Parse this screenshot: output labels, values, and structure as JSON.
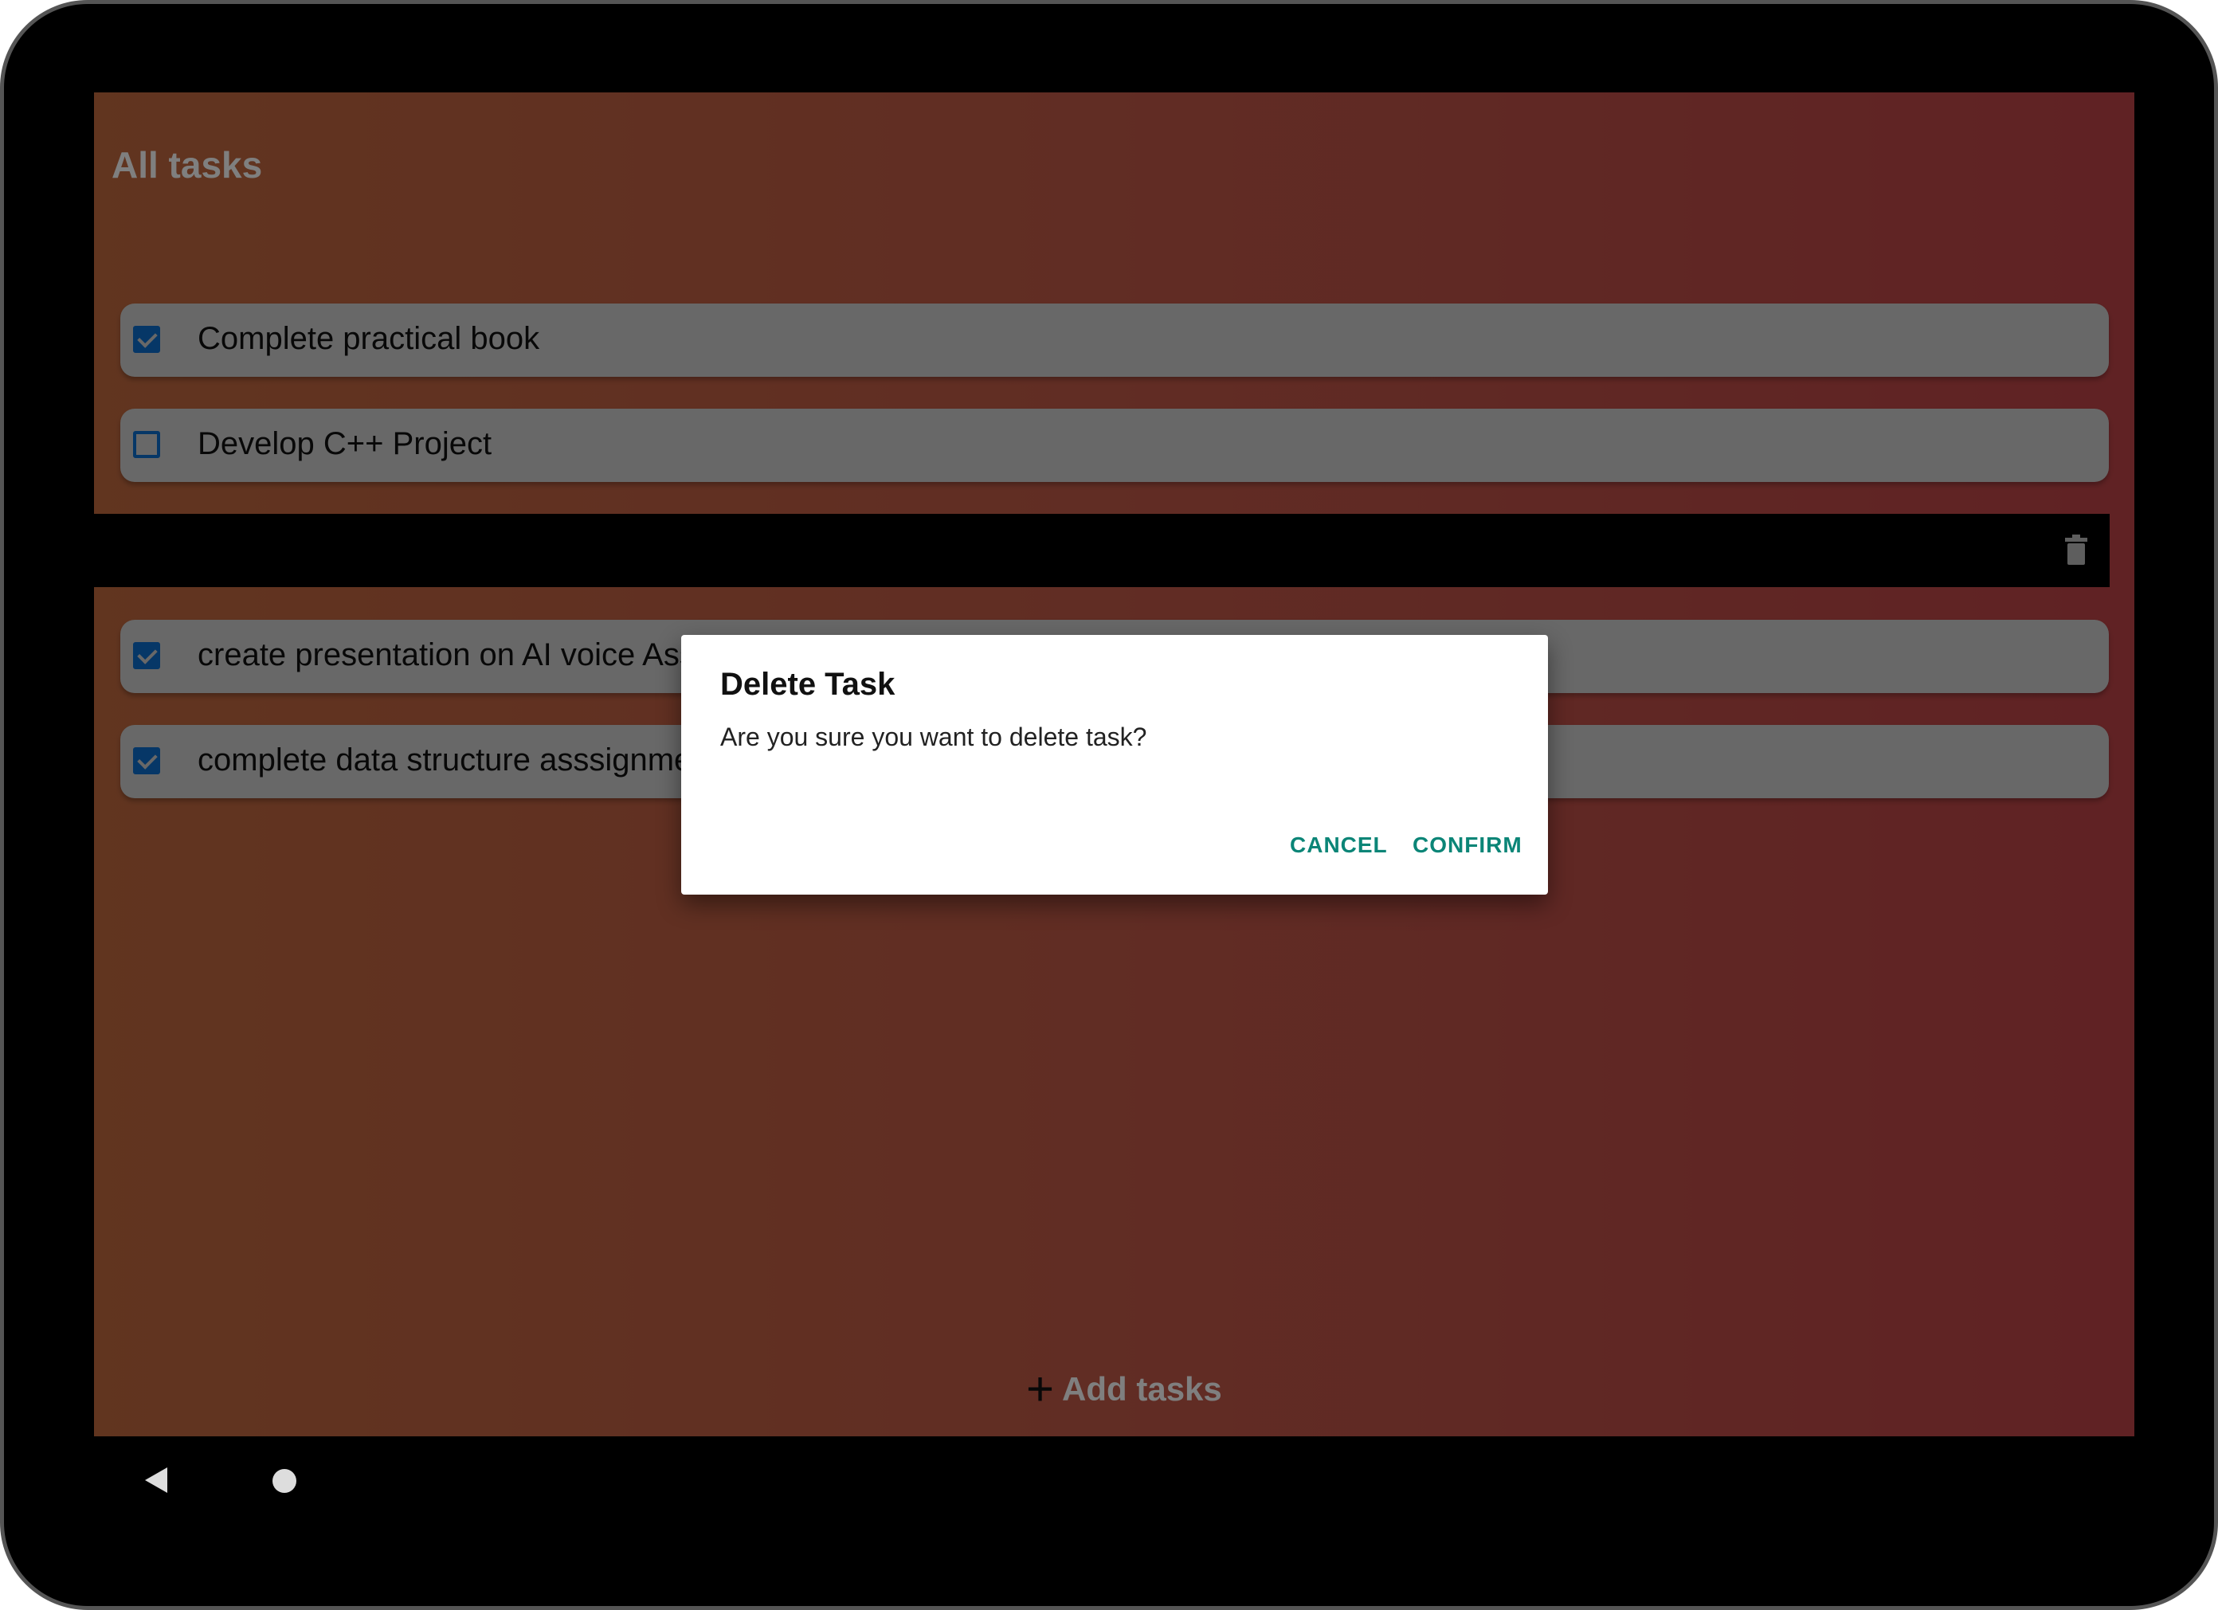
{
  "app": {
    "title": "All tasks",
    "add_tasks_label": "Add tasks"
  },
  "tasks": [
    {
      "label": "Complete practical book",
      "checked": true
    },
    {
      "label": "Develop C++ Project",
      "checked": false
    },
    {
      "label": "create presentation on AI voice Assistant",
      "checked": true
    },
    {
      "label": "complete data structure asssignment",
      "checked": true
    }
  ],
  "dialog": {
    "title": "Delete Task",
    "message": "Are you sure you want to delete task?",
    "cancel_label": "CANCEL",
    "confirm_label": "CONFIRM"
  },
  "colors": {
    "accent": "#0b8577",
    "checkbox": "#0d6ecf",
    "gradient_start": "#c26a3f",
    "gradient_end": "#c04448"
  },
  "icons": {
    "delete": "trash-icon",
    "add": "plus-icon",
    "back": "back-triangle-icon",
    "home": "home-circle-icon"
  }
}
